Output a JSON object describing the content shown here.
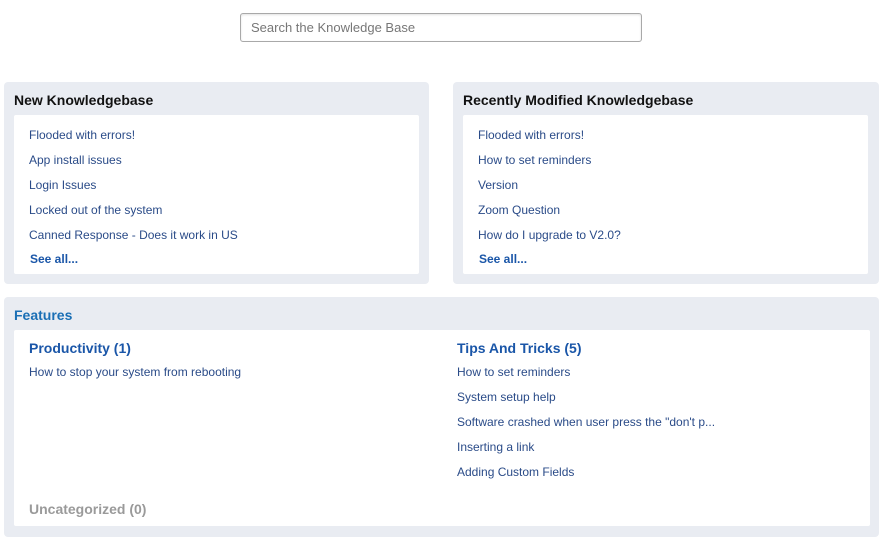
{
  "search": {
    "placeholder": "Search the Knowledge Base"
  },
  "new_kb": {
    "title": "New Knowledgebase",
    "items": [
      "Flooded with errors!",
      "App install issues",
      "Login Issues",
      "Locked out of the system",
      "Canned Response - Does it work in US"
    ],
    "see_all": "See all..."
  },
  "recent_kb": {
    "title": "Recently Modified Knowledgebase",
    "items": [
      "Flooded with errors!",
      "How to set reminders",
      "Version",
      "Zoom Question",
      "How do I upgrade to V2.0?"
    ],
    "see_all": "See all..."
  },
  "features": {
    "title": "Features",
    "categories": [
      {
        "title": "Productivity (1)",
        "items": [
          "How to stop your system from rebooting"
        ]
      },
      {
        "title": "Tips And Tricks (5)",
        "items": [
          "How to set reminders",
          "System setup help",
          "Software crashed when user press the \"don't p...",
          "Inserting a link",
          "Adding Custom Fields"
        ]
      }
    ],
    "uncategorized": "Uncategorized (0)"
  },
  "colors": {
    "panel_bg": "#e9ecf2",
    "link": "#2a4b88",
    "heading_link": "#1a56a8",
    "features_title": "#1a6fb5",
    "muted": "#9a9a9a"
  }
}
